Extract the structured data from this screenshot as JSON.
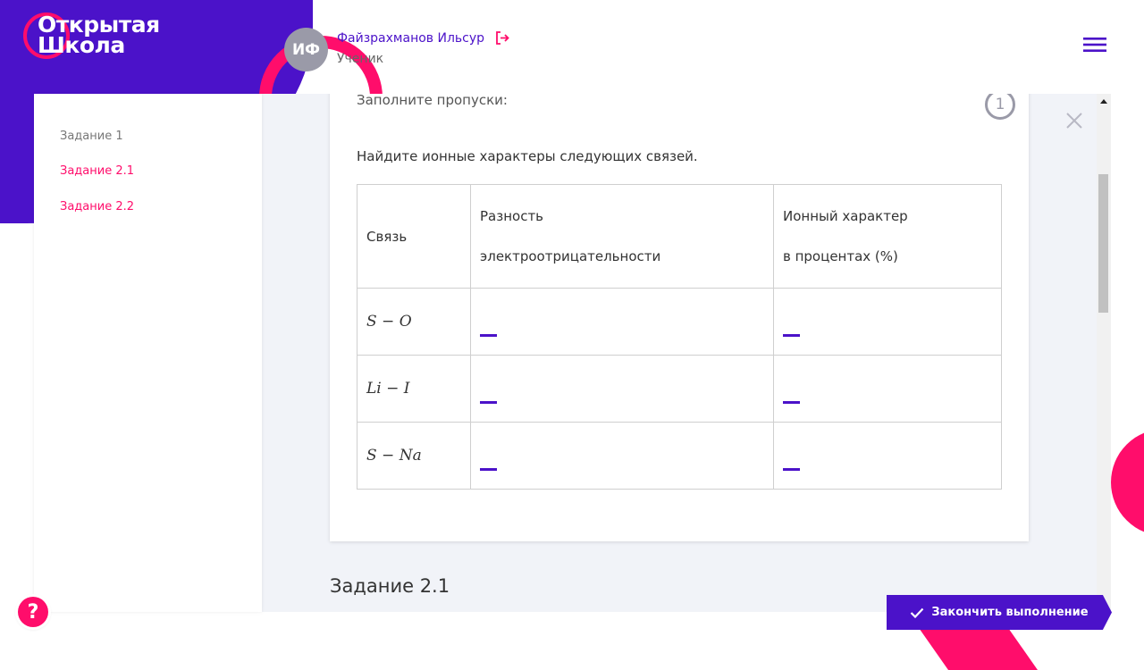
{
  "logo": {
    "line1": "Открытая",
    "line2": "Школа"
  },
  "user": {
    "initials": "ИФ",
    "name": "Файзрахманов Ильсур",
    "role": "Ученик"
  },
  "sidebar": {
    "items": [
      {
        "label": "Задание 1",
        "color": "#777777"
      },
      {
        "label": "Задание 2.1",
        "color": "#ff0d6b"
      },
      {
        "label": "Задание 2.2",
        "color": "#ff0d6b"
      }
    ]
  },
  "task": {
    "instruction": "Заполните пропуски:",
    "number": "1",
    "question": "Найдите ионные характеры следующих связей.",
    "table": {
      "headers": {
        "col1": "Связь",
        "col2_line1": "Разность",
        "col2_line2": "электроотрицательности",
        "col3_line1": "Ионный характер",
        "col3_line2": "в процентах (%)"
      },
      "rows": [
        {
          "bond": "S − O"
        },
        {
          "bond": "Li − I"
        },
        {
          "bond": "S − Na"
        }
      ]
    }
  },
  "next_section_title": "Задание 2.1",
  "buttons": {
    "finish": "Закончить выполнение",
    "help": "?"
  },
  "colors": {
    "brand_purple": "#4b12c9",
    "accent_pink": "#ff0d6b"
  },
  "icons": [
    "logout-icon",
    "menu-icon",
    "close-icon",
    "check-icon",
    "help-icon"
  ]
}
